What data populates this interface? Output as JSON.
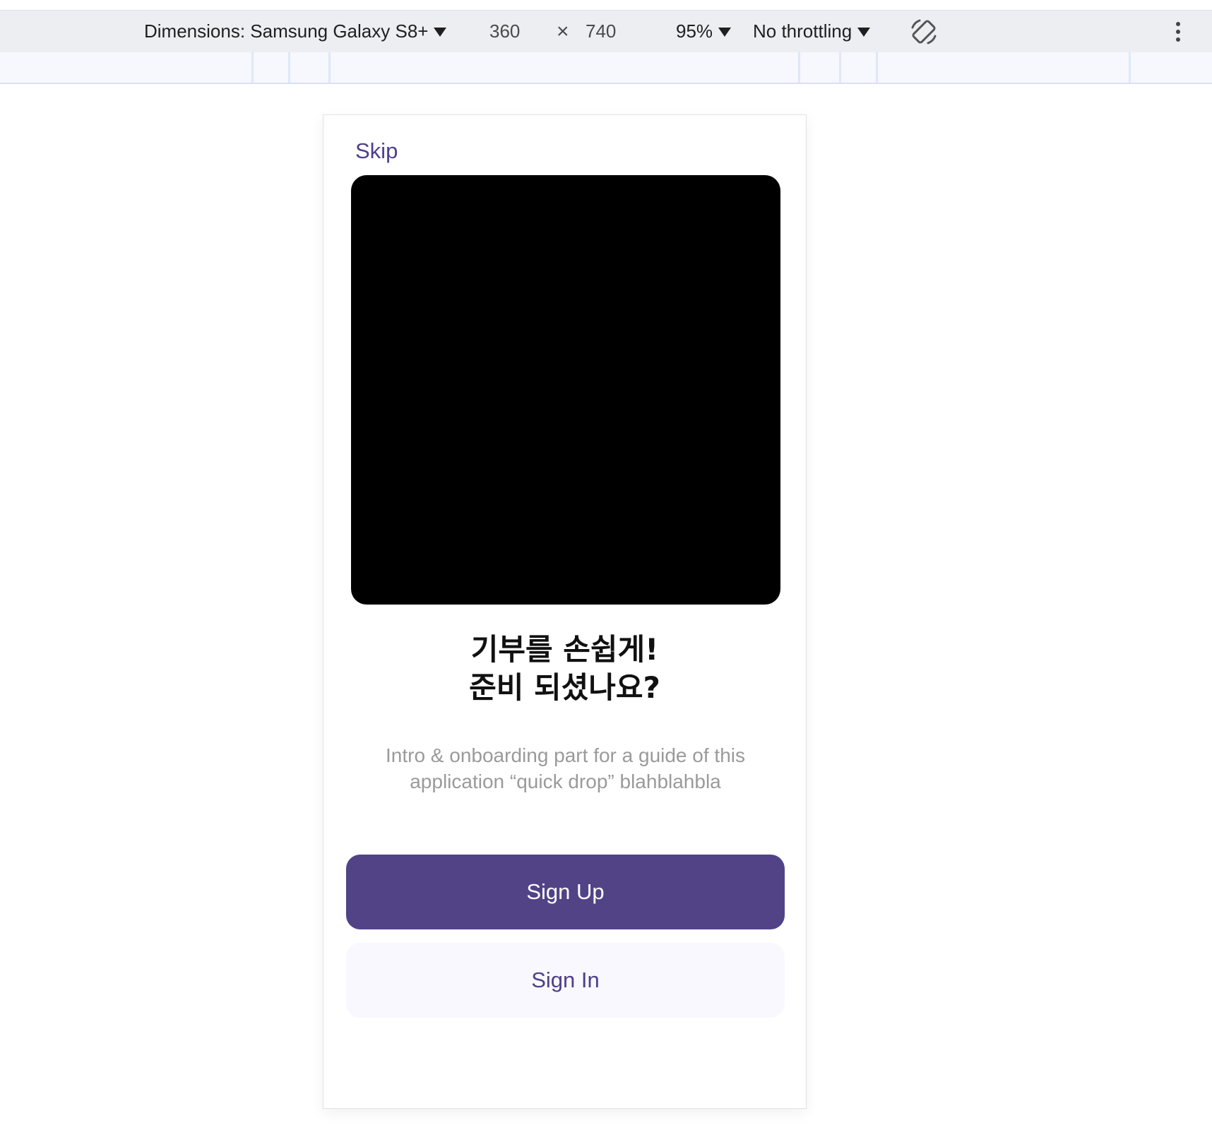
{
  "devtools": {
    "dimensions_label": "Dimensions: Samsung Galaxy S8+",
    "width": "360",
    "times": "×",
    "height": "740",
    "zoom": "95%",
    "throttling": "No throttling",
    "rotate_icon": "rotate-icon",
    "more_icon": "kebab-menu-icon"
  },
  "onboarding": {
    "skip_label": "Skip",
    "title_line1": "기부를 손쉽게!",
    "title_line2": "준비 되셨나요?",
    "description": "Intro & onboarding part for a guide of this application “quick drop” blahblahbla",
    "primary_button": "Sign Up",
    "secondary_button": "Sign In"
  },
  "colors": {
    "accent": "#524387",
    "accent_text": "#4e3f8a",
    "secondary_bg": "#f9f8fe",
    "hero_bg": "#000000"
  }
}
